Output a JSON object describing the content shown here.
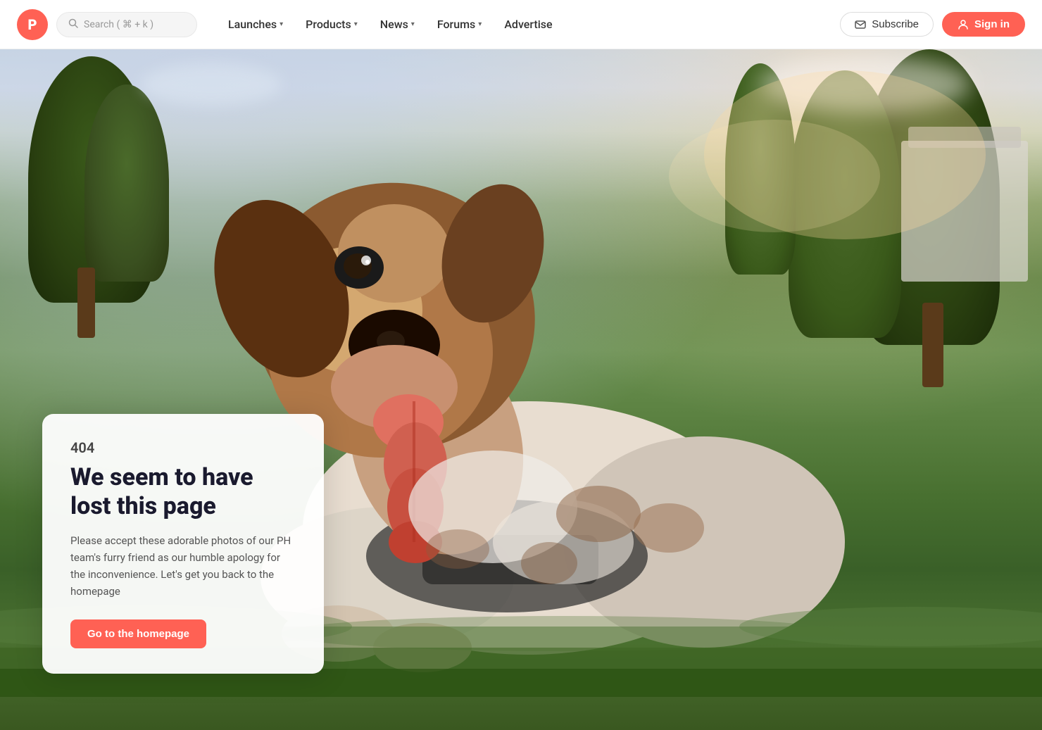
{
  "header": {
    "logo_letter": "P",
    "search_placeholder": "Search ( ⌘ + k )",
    "nav_items": [
      {
        "label": "Launches",
        "has_dropdown": true
      },
      {
        "label": "Products",
        "has_dropdown": true
      },
      {
        "label": "News",
        "has_dropdown": true
      },
      {
        "label": "Forums",
        "has_dropdown": true
      },
      {
        "label": "Advertise",
        "has_dropdown": false
      }
    ],
    "subscribe_label": "Subscribe",
    "signin_label": "Sign in"
  },
  "error_page": {
    "code": "404",
    "title_line1": "We seem to have",
    "title_line2": "lost this page",
    "description": "Please accept these adorable photos of our PH team's furry friend as our humble apology for the inconvenience. Let's get you back to the homepage",
    "cta_label": "Go to the homepage"
  },
  "colors": {
    "brand": "#ff6154",
    "text_dark": "#1a1a2e",
    "text_muted": "#555555"
  }
}
